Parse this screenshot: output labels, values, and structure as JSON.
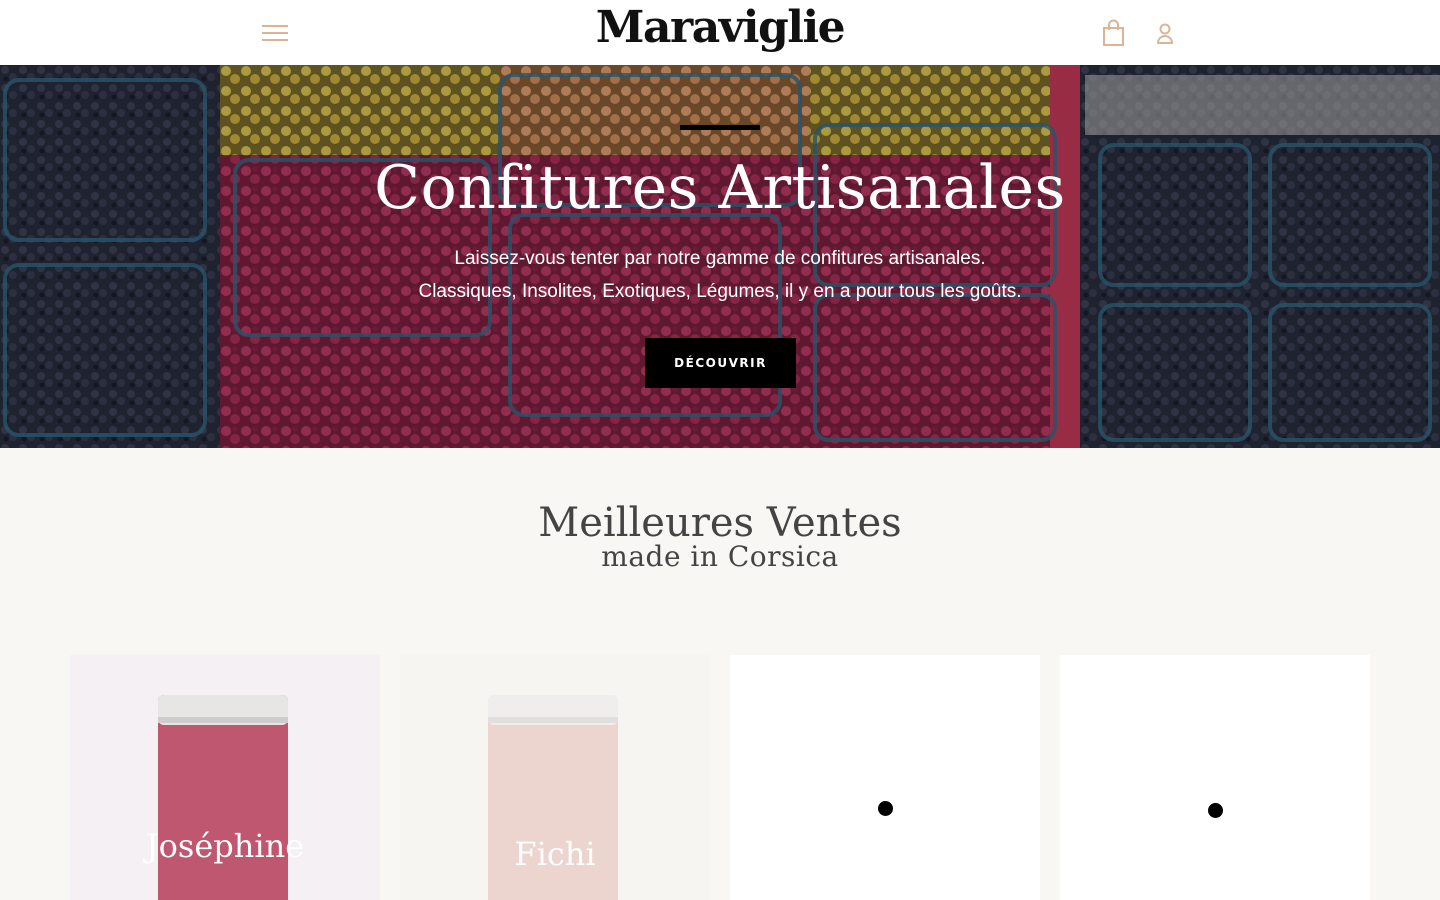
{
  "header": {
    "logo": "Maraviglie",
    "menu_icon": "hamburger-menu-icon",
    "cart_icon": "shopping-bag-icon",
    "account_icon": "user-account-icon",
    "accent_color": "#d9b596"
  },
  "hero": {
    "title": "Confitures Artisanales",
    "subtitle_line1": "Laissez-vous tenter par notre gamme de confitures artisanales.",
    "subtitle_line2": "Classiques, Insolites, Exotiques, Légumes, il y en a pour tous les goûts.",
    "cta_label": "DÉCOUVRIR"
  },
  "bestsellers": {
    "title": "Meilleures Ventes",
    "subtitle": "made in Corsica",
    "products": [
      {
        "label": "Joséphine"
      },
      {
        "label": "Fichi"
      },
      {
        "label": ""
      },
      {
        "label": ""
      }
    ]
  }
}
